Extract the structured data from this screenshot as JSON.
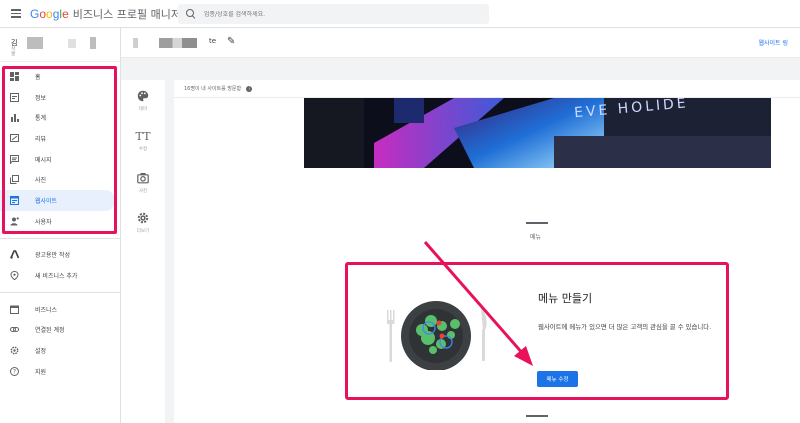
{
  "app": {
    "logo": [
      "G",
      "o",
      "o",
      "g",
      "l",
      "e"
    ],
    "logo_colors": [
      "#4285f4",
      "#ea4335",
      "#fbbc05",
      "#4285f4",
      "#34a853",
      "#ea4335"
    ],
    "title": "비즈니스 프로필 매니저"
  },
  "search": {
    "placeholder": "업종/상호를 검색하세요."
  },
  "business": {
    "initial": "김",
    "sub1": "서",
    "sub2": "울"
  },
  "sidebar": {
    "items": [
      {
        "label": "홈",
        "icon": "dashboard-icon"
      },
      {
        "label": "정보",
        "icon": "info-store-icon"
      },
      {
        "label": "통계",
        "icon": "bar-chart-icon"
      },
      {
        "label": "리뷰",
        "icon": "review-icon"
      },
      {
        "label": "메시지",
        "icon": "message-icon"
      },
      {
        "label": "사진",
        "icon": "photo-icon"
      },
      {
        "label": "웹사이트",
        "icon": "website-icon",
        "active": true
      },
      {
        "label": "사용자",
        "icon": "add-user-icon"
      }
    ],
    "items2": [
      {
        "label": "광고용만 작성",
        "icon": "ads-icon"
      },
      {
        "label": "새 비즈니스 추가",
        "icon": "location-icon"
      }
    ],
    "items3": [
      {
        "label": "비즈니스",
        "icon": "business-icon"
      },
      {
        "label": "연결된 계정",
        "icon": "link-icon"
      },
      {
        "label": "설정",
        "icon": "settings-icon"
      },
      {
        "label": "지원",
        "icon": "help-icon"
      }
    ]
  },
  "page_header": {
    "text": "te",
    "website_link": "웹사이트 링"
  },
  "tools": [
    {
      "label": "테마",
      "icon": "palette-icon"
    },
    {
      "label": "수정",
      "icon": "text-icon"
    },
    {
      "label": "사진",
      "icon": "camera-icon"
    },
    {
      "label": "더보기",
      "icon": "gear-icon"
    }
  ],
  "panel": {
    "visitors": "16명이 내 사이트를 방문함"
  },
  "menu_section": {
    "label": "메뉴",
    "card_title": "메뉴 만들기",
    "card_desc": "웹사이트에 메뉴가 있으면 더 많은 고객의 관심을 끌 수 있습니다.",
    "button": "메뉴 수정"
  },
  "colors": {
    "accent": "#1a73e8",
    "highlight": "#e8115b"
  }
}
